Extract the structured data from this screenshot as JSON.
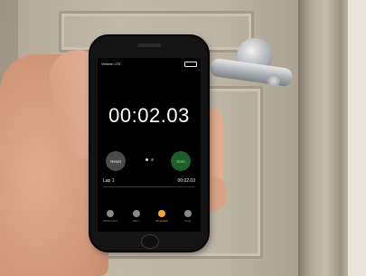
{
  "status_bar": {
    "carrier": "Verizon LTE"
  },
  "stopwatch": {
    "time": "00:02.03"
  },
  "buttons": {
    "reset": "Reset",
    "start": "Start"
  },
  "lap": {
    "label": "Lap 1",
    "time": "00:02.03"
  },
  "tabs": [
    {
      "label": "World Clock",
      "icon": "globe-icon",
      "active": false
    },
    {
      "label": "Alarm",
      "icon": "alarm-icon",
      "active": false
    },
    {
      "label": "Stopwatch",
      "icon": "stopwatch-icon",
      "active": true
    },
    {
      "label": "Timer",
      "icon": "timer-icon",
      "active": false
    }
  ],
  "colors": {
    "accent": "#f3a43b",
    "start_green": "#1d5e2a",
    "reset_gray": "#4a4a4a"
  }
}
